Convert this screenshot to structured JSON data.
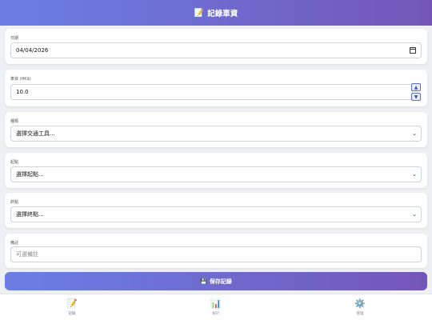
{
  "header": {
    "icon": "📝",
    "title": "記錄車資"
  },
  "form": {
    "date": {
      "label": "日期",
      "value": "04/04/2026"
    },
    "fare": {
      "label": "車資 (HK$)",
      "value": "10.0",
      "up": "▲",
      "down": "▼"
    },
    "type": {
      "label": "種類",
      "value": "選擇交通工具..."
    },
    "start": {
      "label": "起點",
      "value": "選擇起點..."
    },
    "end": {
      "label": "終點",
      "value": "選擇終點..."
    },
    "note": {
      "label": "備註",
      "placeholder": "可選備註"
    }
  },
  "save_button": {
    "icon": "💾",
    "label": "保存記錄"
  },
  "nav": [
    {
      "icon": "📝",
      "label": "記錄",
      "active": true
    },
    {
      "icon": "📊",
      "label": "統計",
      "active": false
    },
    {
      "icon": "⚙️",
      "label": "管理",
      "active": false
    }
  ],
  "chevron": "⌄"
}
